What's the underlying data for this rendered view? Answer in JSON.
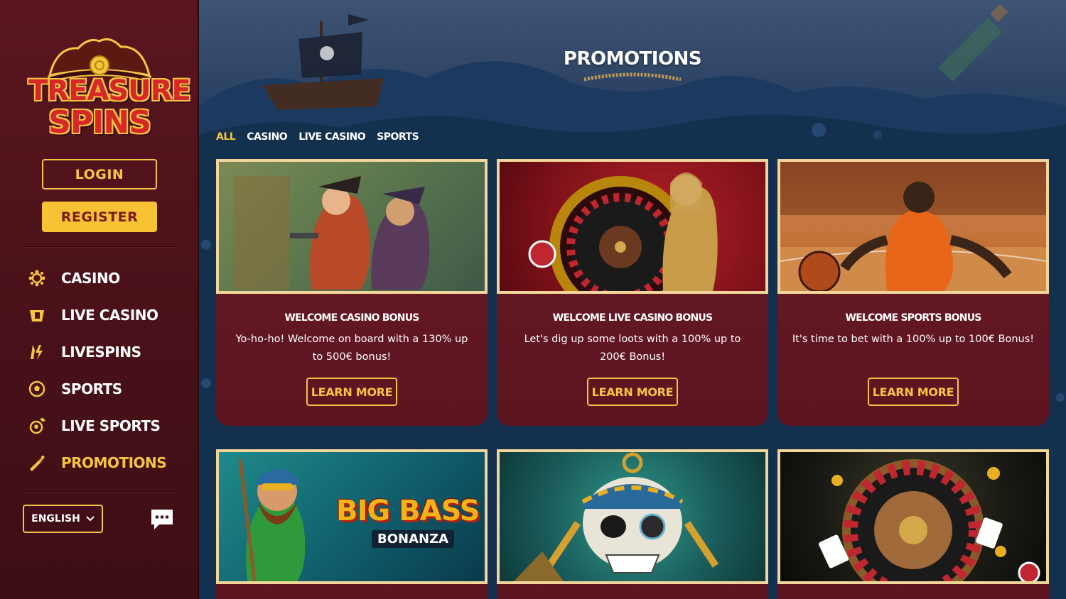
{
  "brand": {
    "line1": "TREASURE",
    "line2": "SPINS"
  },
  "auth": {
    "login_label": "LOGIN",
    "register_label": "REGISTER"
  },
  "nav": [
    {
      "label": "CASINO",
      "icon": "coins-icon"
    },
    {
      "label": "LIVE CASINO",
      "icon": "card-table-icon"
    },
    {
      "label": "LIVESPINS",
      "icon": "lightning-icon"
    },
    {
      "label": "SPORTS",
      "icon": "soccer-ball-icon"
    },
    {
      "label": "LIVE SPORTS",
      "icon": "live-ball-icon"
    },
    {
      "label": "PROMOTIONS",
      "icon": "trumpet-icon"
    }
  ],
  "language": {
    "selected": "ENGLISH"
  },
  "page": {
    "title": "PROMOTIONS"
  },
  "filters": [
    "ALL",
    "CASINO",
    "LIVE CASINO",
    "SPORTS"
  ],
  "cards": [
    {
      "title": "WELCOME CASINO BONUS",
      "text": "Yo-ho-ho! Welcome on board with a 130% up to 500€ bonus!",
      "button": "LEARN MORE"
    },
    {
      "title": "WELCOME LIVE CASINO BONUS",
      "text": "Let's dig up some loots with a 100% up to 200€ Bonus!",
      "button": "LEARN MORE"
    },
    {
      "title": "WELCOME SPORTS BONUS",
      "text": "It's time to bet with a 100% up to 100€ Bonus!",
      "button": "LEARN MORE"
    }
  ],
  "promo_images": {
    "big_bass_title": "BIG BASS",
    "big_bass_sub": "BONANZA"
  },
  "colors": {
    "accent": "#f5c542",
    "sidebar": "#4a1119",
    "card": "#6a1a26",
    "ocean": "#173556"
  }
}
